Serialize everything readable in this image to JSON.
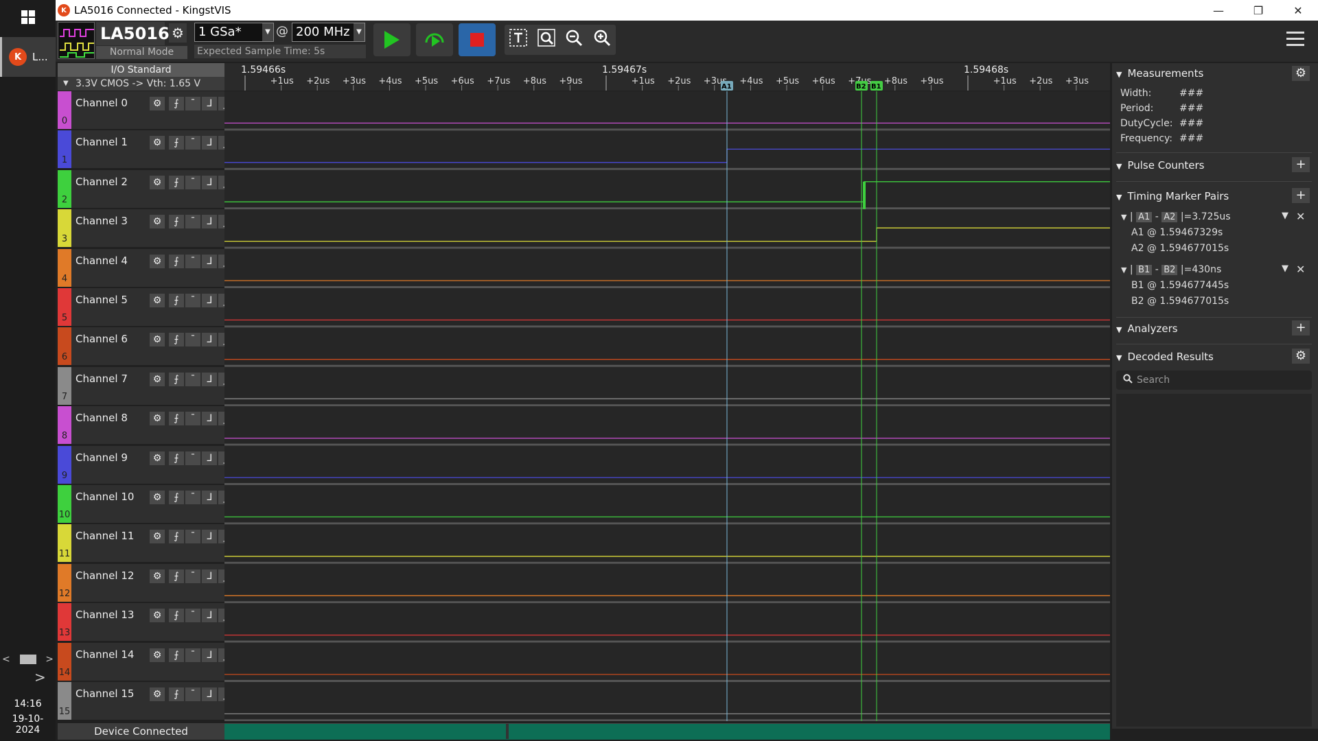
{
  "taskbar": {
    "app_label": "L...",
    "time": "14:16",
    "date": "19-10-2024"
  },
  "window": {
    "title": "LA5016 Connected - KingstVIS",
    "minimize": "—",
    "restore": "❐",
    "close": "✕"
  },
  "toolbar": {
    "device_name": "LA5016",
    "device_mode": "Normal Mode",
    "sample_rate": "1 GSa*",
    "at": "@",
    "frequency": "200 MHz",
    "expected_time": "Expected Sample Time: 5s"
  },
  "io": {
    "header": "I/O Standard",
    "standard": "3.3V CMOS  -> Vth: 1.65 V"
  },
  "channels": [
    {
      "name": "Channel 0",
      "num": "0",
      "color": "#c84fd0"
    },
    {
      "name": "Channel 1",
      "num": "1",
      "color": "#4a4ad8"
    },
    {
      "name": "Channel 2",
      "num": "2",
      "color": "#3ed03e"
    },
    {
      "name": "Channel 3",
      "num": "3",
      "color": "#d8d838"
    },
    {
      "name": "Channel 4",
      "num": "4",
      "color": "#e07a28"
    },
    {
      "name": "Channel 5",
      "num": "5",
      "color": "#e03838"
    },
    {
      "name": "Channel 6",
      "num": "6",
      "color": "#c84a1e"
    },
    {
      "name": "Channel 7",
      "num": "7",
      "color": "#8a8a8a"
    },
    {
      "name": "Channel 8",
      "num": "8",
      "color": "#c84fd0"
    },
    {
      "name": "Channel 9",
      "num": "9",
      "color": "#4a4ad8"
    },
    {
      "name": "Channel 10",
      "num": "10",
      "color": "#3ed03e"
    },
    {
      "name": "Channel 11",
      "num": "11",
      "color": "#d8d838"
    },
    {
      "name": "Channel 12",
      "num": "12",
      "color": "#e07a28"
    },
    {
      "name": "Channel 13",
      "num": "13",
      "color": "#e03838"
    },
    {
      "name": "Channel 14",
      "num": "14",
      "color": "#c84a1e"
    },
    {
      "name": "Channel 15",
      "num": "15",
      "color": "#8a8a8a"
    }
  ],
  "ruler": {
    "major": [
      "1.59466s",
      "1.59467s",
      "1.59468s"
    ],
    "minor": [
      "+1us",
      "+2us",
      "+3us",
      "+4us",
      "+5us",
      "+6us",
      "+7us",
      "+8us",
      "+9us",
      "+1us",
      "+2us",
      "+3us",
      "+4us",
      "+5us",
      "+6us",
      "+7us",
      "+8us",
      "+9us",
      "+1us",
      "+2us",
      "+3us"
    ],
    "markers": [
      "A1",
      "B2",
      "B1"
    ]
  },
  "status": "Device Connected",
  "panel": {
    "measurements": {
      "title": "Measurements",
      "rows": [
        {
          "k": "Width:",
          "v": "###"
        },
        {
          "k": "Period:",
          "v": "###"
        },
        {
          "k": "DutyCycle:",
          "v": "###"
        },
        {
          "k": "Frequency:",
          "v": "###"
        }
      ]
    },
    "pulse_counters": "Pulse Counters",
    "timing_pairs": {
      "title": "Timing Marker Pairs",
      "pair_a": {
        "t1": "A1",
        "t2": "A2",
        "delta": "|=3.725us",
        "line1": "A1 @ 1.59467329s",
        "line2": "A2 @ 1.594677015s"
      },
      "pair_b": {
        "t1": "B1",
        "t2": "B2",
        "delta": "|=430ns",
        "line1": "B1 @ 1.594677445s",
        "line2": "B2 @ 1.594677015s"
      }
    },
    "analyzers": "Analyzers",
    "decoded": "Decoded Results",
    "search_placeholder": "Search"
  }
}
